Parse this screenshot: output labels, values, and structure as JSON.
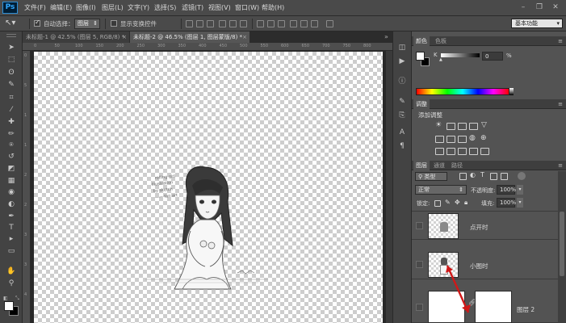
{
  "app": {
    "logo": "Ps"
  },
  "menu": [
    "文件(F)",
    "编辑(E)",
    "图像(I)",
    "图层(L)",
    "文字(Y)",
    "选择(S)",
    "滤镜(T)",
    "视图(V)",
    "窗口(W)",
    "帮助(H)"
  ],
  "window_controls": {
    "minimize": "–",
    "restore": "❐",
    "close": "✕"
  },
  "options": {
    "auto_select_label": "自动选择：",
    "auto_select_value": "图层",
    "show_transform_label": "显示变换控件",
    "workspace": "基本功能"
  },
  "tabs": [
    {
      "label": "未标题-1 @ 42.5% (图层 5, RGB/8) *",
      "close": "×"
    },
    {
      "label": "未标题-2 @ 46.5% (图层 1, 图层蒙版/8) *",
      "close": "×"
    }
  ],
  "tools": [
    "move-icon",
    "marquee-icon",
    "lasso-icon",
    "quick-select-icon",
    "crop-icon",
    "eyedropper-icon",
    "healing-icon",
    "brush-icon",
    "stamp-icon",
    "history-brush-icon",
    "eraser-icon",
    "gradient-icon",
    "blur-icon",
    "dodge-icon",
    "pen-icon",
    "type-icon",
    "path-select-icon",
    "shape-icon",
    "hand-icon",
    "zoom-icon"
  ],
  "tool_glyphs": [
    "➤",
    "⬚",
    "ʘ",
    "✎",
    "⌗",
    "⁄",
    "✚",
    "✏",
    "⍟",
    "↺",
    "◩",
    "▦",
    "◉",
    "◐",
    "✒",
    "T",
    "▸",
    "▭",
    "✋",
    "⚲"
  ],
  "ruler_marks": [
    "0",
    "50",
    "100",
    "150",
    "200",
    "250",
    "300",
    "350",
    "400",
    "450",
    "500",
    "550",
    "600",
    "650",
    "700",
    "750",
    "800"
  ],
  "ruler_v_marks": [
    "0",
    "5",
    "1",
    "1",
    "2",
    "2",
    "3",
    "3",
    "4"
  ],
  "color_panel": {
    "tabs": [
      "颜色",
      "色板"
    ],
    "channel_label": "K",
    "value": "0",
    "unit": "%"
  },
  "adjust_panel": {
    "tab": "调整",
    "title": "添加调整"
  },
  "layers_panel": {
    "tabs": [
      "图层",
      "通道",
      "路径"
    ],
    "filter": "类型",
    "blend_mode": "正常",
    "opacity_label": "不透明度:",
    "opacity_value": "100%",
    "lock_label": "锁定:",
    "fill_label": "填充:",
    "fill_value": "100%",
    "layers": [
      {
        "name": "点开时"
      },
      {
        "name": "小图时"
      },
      {
        "name": "图层 2"
      }
    ]
  },
  "canvas_text": {
    "scribble": [
      "rolling girl",
      "illustration",
      "by sketch",
      "—— fan art"
    ]
  }
}
